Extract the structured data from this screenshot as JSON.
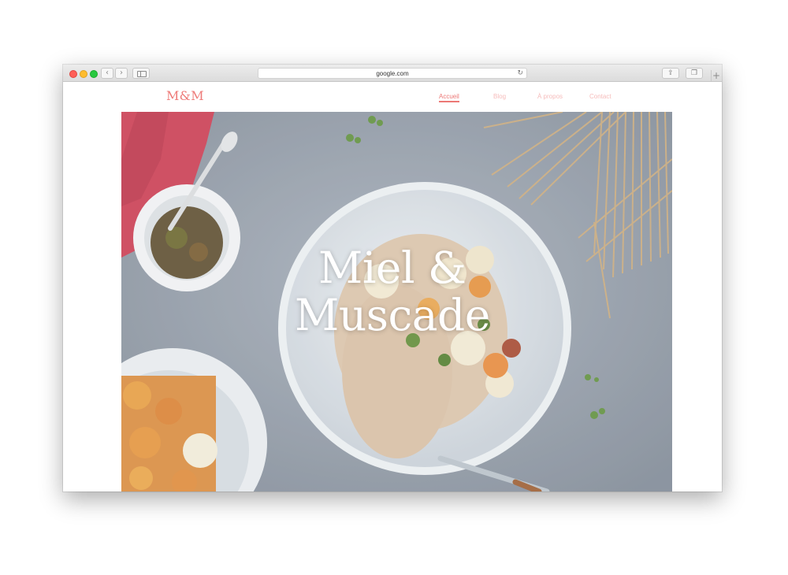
{
  "browser": {
    "url": "google.com",
    "icons": {
      "back": "chevron-left-icon",
      "forward": "chevron-right-icon",
      "sidebar": "sidebar-icon",
      "reload": "reload-icon",
      "share": "share-icon",
      "tabs": "tabs-icon",
      "new_tab": "plus-icon"
    }
  },
  "site": {
    "logo": "M&M",
    "nav": [
      {
        "label": "Accueil",
        "active": true
      },
      {
        "label": "Blog",
        "active": false
      },
      {
        "label": "À propos",
        "active": false
      },
      {
        "label": "Contact",
        "active": false
      }
    ],
    "hero": {
      "title_line1": "Miel &",
      "title_line2": "Muscade"
    }
  },
  "colors": {
    "brand": "#ee7b79",
    "nav_inactive": "#f6bcbb",
    "hero_text": "#ffffff"
  }
}
